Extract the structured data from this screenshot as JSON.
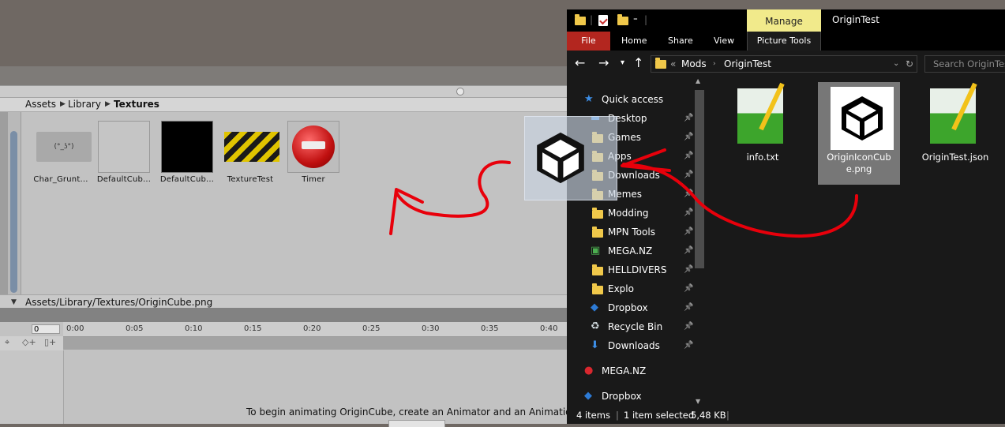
{
  "unity": {
    "breadcrumb": [
      "Assets",
      "Library",
      "Textures"
    ],
    "assets": [
      {
        "label": "Char_Grunt..."
      },
      {
        "label": "DefaultCub..."
      },
      {
        "label": "DefaultCub..."
      },
      {
        "label": "TextureTest"
      },
      {
        "label": "Timer"
      }
    ],
    "selected_path": "Assets/Library/Textures/OriginCube.png",
    "anim_frame": "0",
    "anim_ticks": [
      "0:00",
      "0:05",
      "0:10",
      "0:15",
      "0:20",
      "0:25",
      "0:30",
      "0:35",
      "0:40"
    ],
    "anim_message": "To begin animating OriginCube, create an Animator and an Animation C"
  },
  "explorer": {
    "manage_tab": "Manage",
    "window_title": "OriginTest",
    "ribbon_tabs": {
      "file": "File",
      "home": "Home",
      "share": "Share",
      "view": "View",
      "picture_tools": "Picture Tools"
    },
    "address": {
      "prefix": "«",
      "crumbs": [
        "Mods",
        "OriginTest"
      ]
    },
    "search_placeholder": "Search OriginTest",
    "nav": [
      {
        "label": "Quick access",
        "icon": "star-icon"
      },
      {
        "label": "Desktop",
        "icon": "desktop-icon",
        "pinned": true
      },
      {
        "label": "Games",
        "icon": "folder-icon",
        "pinned": true
      },
      {
        "label": "Apps",
        "icon": "folder-icon",
        "pinned": true
      },
      {
        "label": "Downloads",
        "icon": "folder-icon",
        "pinned": true
      },
      {
        "label": "Memes",
        "icon": "folder-icon",
        "pinned": true
      },
      {
        "label": "Modding",
        "icon": "folder-icon",
        "pinned": true
      },
      {
        "label": "MPN Tools",
        "icon": "folder-icon",
        "pinned": true
      },
      {
        "label": "MEGA.NZ",
        "icon": "mega-folder-icon",
        "pinned": true
      },
      {
        "label": "HELLDIVERS",
        "icon": "folder-icon",
        "pinned": true
      },
      {
        "label": "Explo",
        "icon": "folder-icon",
        "pinned": true
      },
      {
        "label": "Dropbox",
        "icon": "dropbox-icon",
        "pinned": true
      },
      {
        "label": "Recycle Bin",
        "icon": "recycle-bin-icon",
        "pinned": true
      },
      {
        "label": "Downloads",
        "icon": "download-arrow-icon",
        "pinned": true
      },
      {
        "label": "MEGA.NZ",
        "icon": "mega-icon"
      },
      {
        "label": "Dropbox",
        "icon": "dropbox-icon"
      }
    ],
    "files": [
      {
        "name": "info.txt",
        "icon": "notepadpp-icon"
      },
      {
        "name": "OriginIconCube.png",
        "icon": "cube-icon",
        "selected": true
      },
      {
        "name": "OriginTest.json",
        "icon": "notepadpp-icon"
      }
    ],
    "status": {
      "items": "4 items",
      "selected": "1 item selected",
      "size": "5,48 KB"
    }
  }
}
